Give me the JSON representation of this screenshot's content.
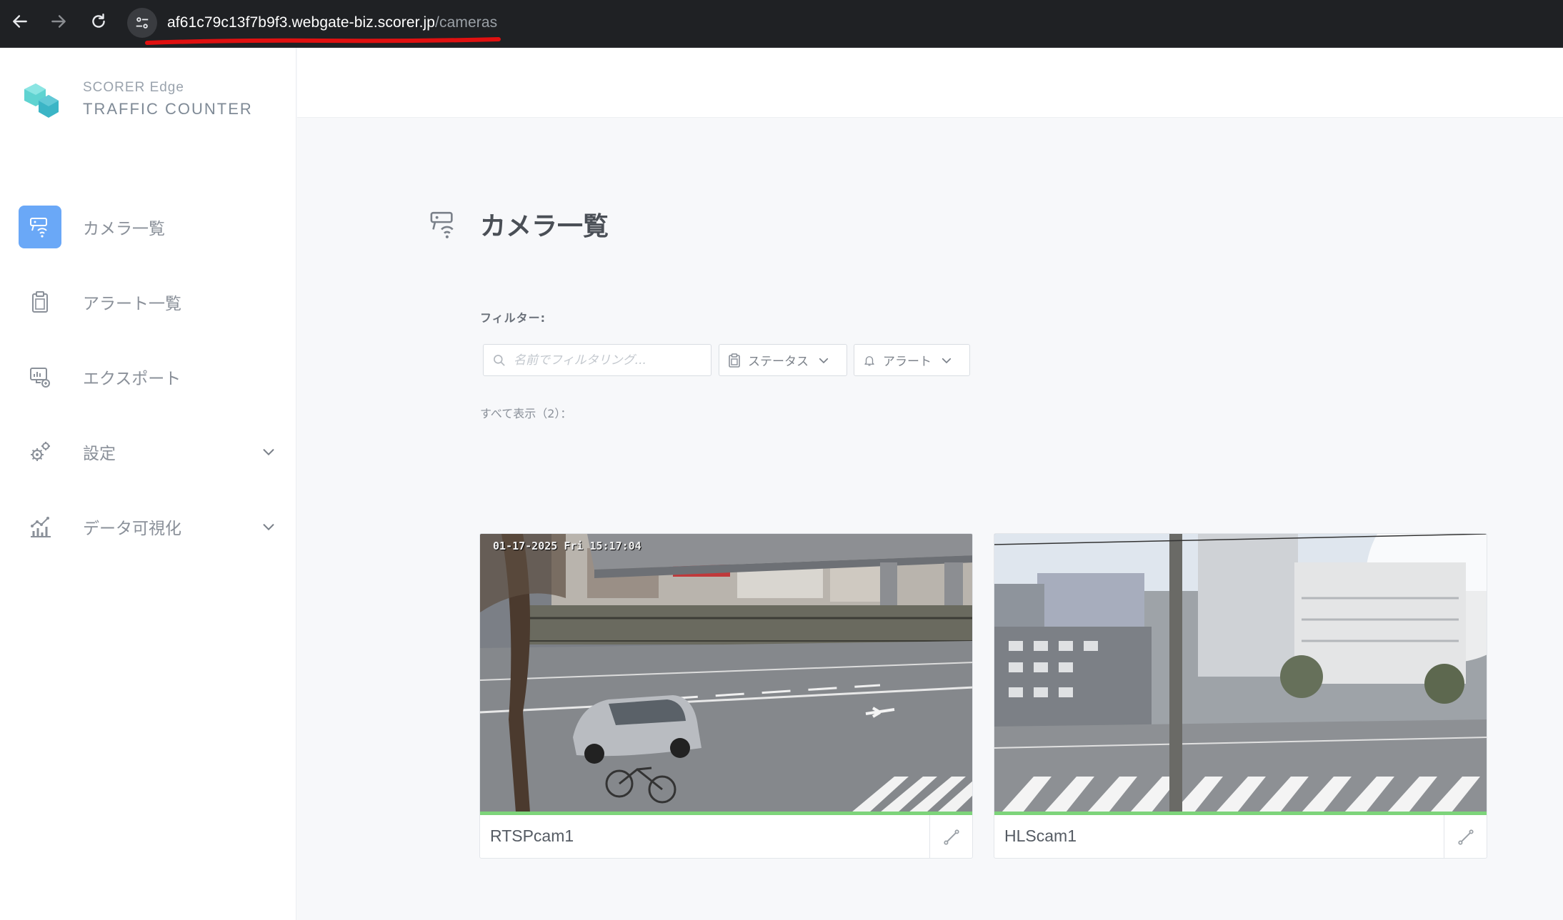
{
  "browser": {
    "url_host": "af61c79c13f7b9f3.webgate-biz.scorer.jp",
    "url_path": "/cameras"
  },
  "brand": {
    "line1": "SCORER Edge",
    "line2": "TRAFFIC COUNTER"
  },
  "sidebar": {
    "items": [
      {
        "label": "カメラ一覧",
        "icon": "camera-wifi-icon",
        "active": true
      },
      {
        "label": "アラート一覧",
        "icon": "clipboard-icon",
        "active": false
      },
      {
        "label": "エクスポート",
        "icon": "export-monitor-icon",
        "active": false
      },
      {
        "label": "設定",
        "icon": "gears-icon",
        "active": false,
        "expandable": true
      },
      {
        "label": "データ可視化",
        "icon": "chart-icon",
        "active": false,
        "expandable": true
      }
    ]
  },
  "main": {
    "title": "カメラ一覧",
    "filter_label": "フィルター:",
    "search_placeholder": "名前でフィルタリング...",
    "status_dropdown": "ステータス",
    "alert_dropdown": "アラート",
    "show_all": "すべて表示（2）："
  },
  "cameras": [
    {
      "name": "RTSPcam1",
      "timestamp": "01-17-2025 Fri 15:17:04",
      "status_color": "#7dd47a"
    },
    {
      "name": "HLScam1",
      "status_color": "#7dd47a"
    }
  ],
  "colors": {
    "accent": "#6aa8f7",
    "status_ok": "#7dd47a",
    "annotation_red": "#e01010"
  }
}
